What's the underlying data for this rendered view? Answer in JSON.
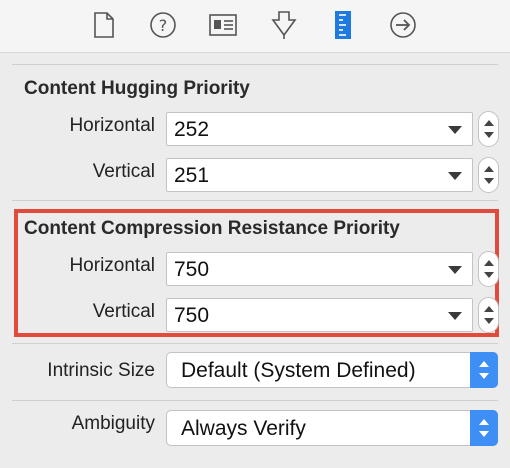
{
  "toolbar": {
    "icons": [
      "file-icon",
      "help-icon",
      "identity-icon",
      "attributes-icon",
      "size-ruler-icon",
      "connections-arrow-icon"
    ],
    "active_icon": "size-ruler-icon",
    "accent": "#1f7ae0"
  },
  "hugging": {
    "title": "Content Hugging Priority",
    "horizontal_label": "Horizontal",
    "horizontal_value": "252",
    "vertical_label": "Vertical",
    "vertical_value": "251"
  },
  "compression": {
    "title": "Content Compression Resistance Priority",
    "horizontal_label": "Horizontal",
    "horizontal_value": "750",
    "vertical_label": "Vertical",
    "vertical_value": "750",
    "highlight_color": "#e24a3b"
  },
  "intrinsic": {
    "label": "Intrinsic Size",
    "value": "Default (System Defined)"
  },
  "ambiguity": {
    "label": "Ambiguity",
    "value": "Always Verify"
  }
}
